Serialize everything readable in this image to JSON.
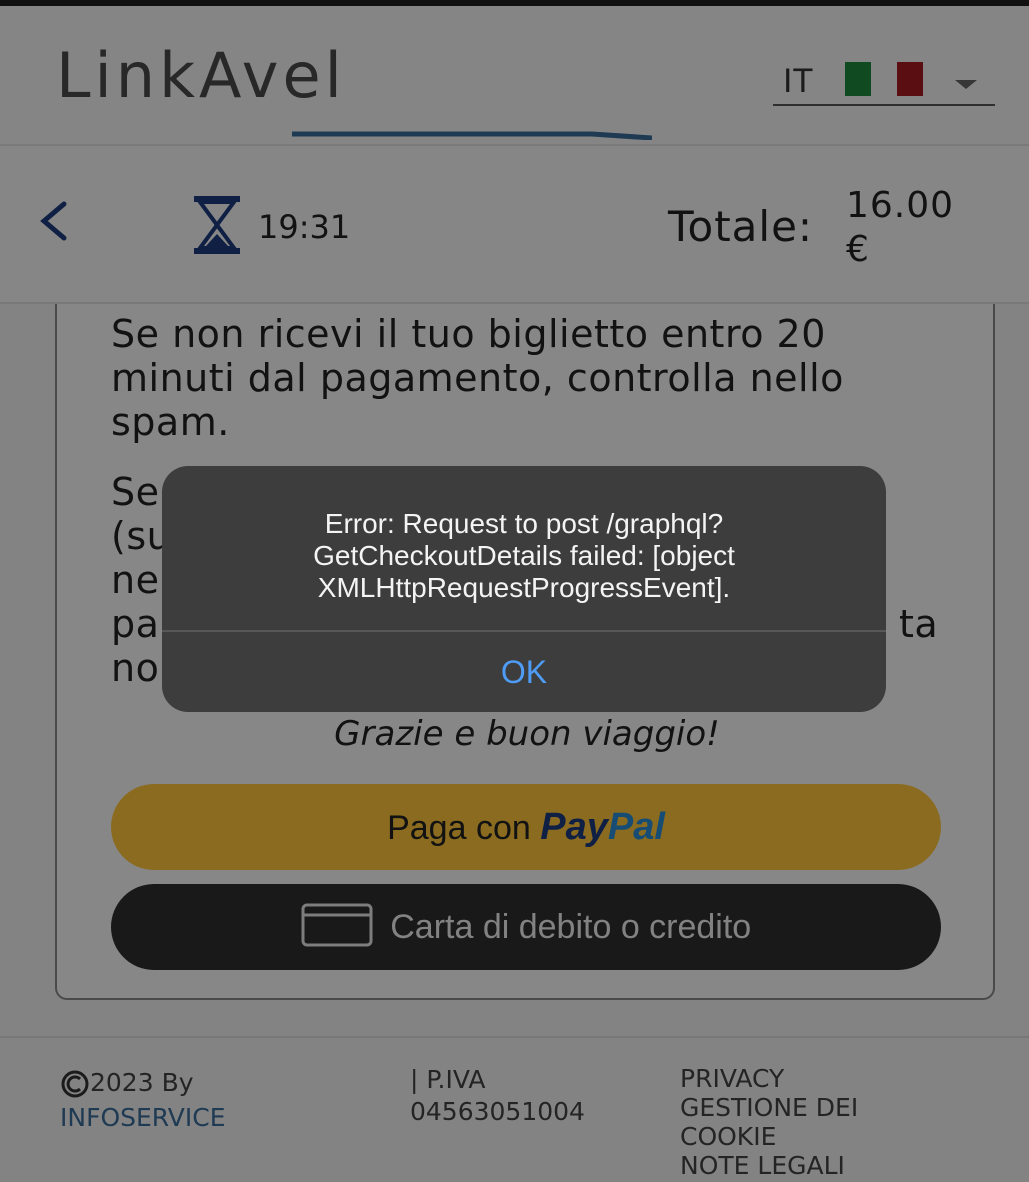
{
  "header": {
    "logo": "LinkAvel",
    "language": "IT",
    "colors": {
      "flag_green": "#1f8a3c",
      "flag_red": "#a81a22",
      "logo_blue": "#3a6b99"
    }
  },
  "checkout": {
    "timer": "19:31",
    "total_label": "Totale:",
    "total_value": "16.00",
    "currency": "€"
  },
  "content": {
    "paragraph1": "Se non ricevi il tuo biglietto entro 20 minuti dal pagamento, controlla nello spam.",
    "paragraph2_lines": [
      "Se",
      "(su",
      "ne",
      "pa",
      "no"
    ],
    "paragraph2_tail": "ta",
    "thanks": "Grazie e buon viaggio!",
    "paypal_prefix": "Paga con",
    "paypal_brand_1": "Pay",
    "paypal_brand_2": "Pal",
    "card_button": "Carta di debito o credito"
  },
  "footer": {
    "copyright": "2023 By",
    "company": "INFOSERVICE",
    "piva_label": "| P.IVA",
    "piva_number": "04563051004",
    "links": [
      "PRIVACY",
      "GESTIONE DEI COOKIE",
      "NOTE LEGALI"
    ]
  },
  "alert": {
    "message": "Error: Request to post /graphql? GetCheckoutDetails failed: [object XMLHttpRequestProgressEvent].",
    "ok_label": "OK"
  }
}
